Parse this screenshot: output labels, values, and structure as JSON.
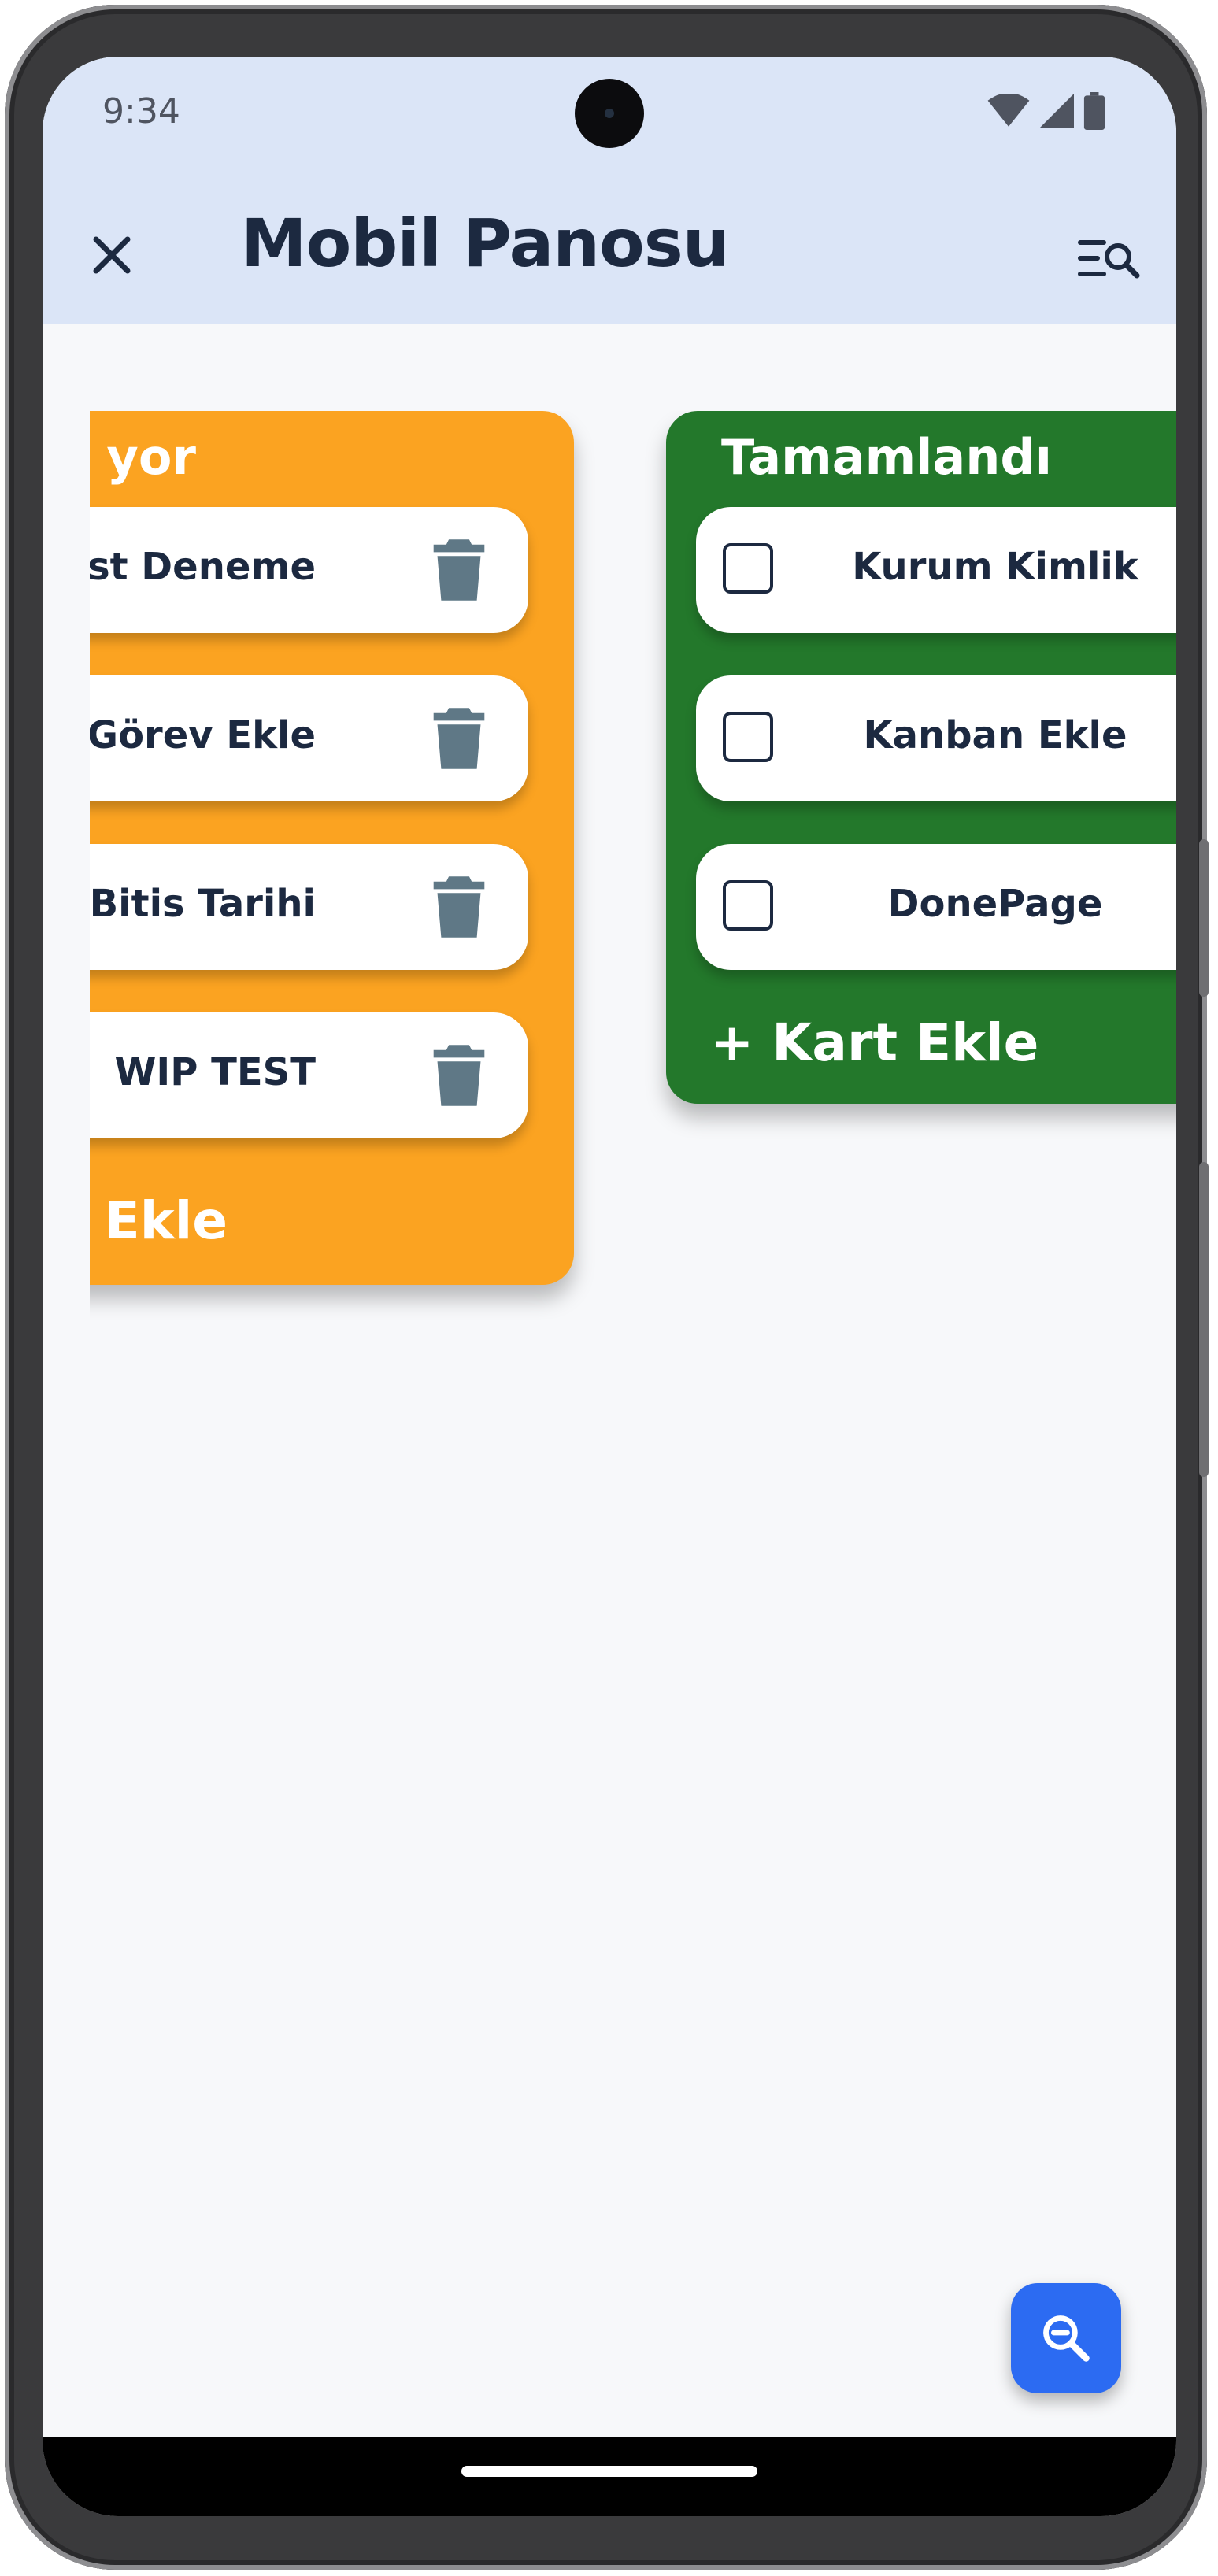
{
  "status_bar": {
    "time": "9:34"
  },
  "app_bar": {
    "title": "Mobil Panosu"
  },
  "columns": [
    {
      "title": "yor",
      "color": "#fba321",
      "cards": [
        {
          "text": "est Deneme"
        },
        {
          "text": "Görev Ekle"
        },
        {
          "text": "Bitis Tarihi"
        },
        {
          "text": "WIP TEST"
        }
      ],
      "add_label": "Ekle"
    },
    {
      "title": "Tamamlandı",
      "color": "#23782b",
      "cards": [
        {
          "text": "Kurum Kimlik"
        },
        {
          "text": "Kanban Ekle"
        },
        {
          "text": "DonePage"
        }
      ],
      "add_label": "+ Kart Ekle"
    }
  ],
  "icons": {
    "close": "close-icon",
    "search_list": "search-list-icon",
    "trash": "trash-icon",
    "zoom_out": "zoom-out-icon"
  },
  "colors": {
    "app_bar_bg": "#dbe5f7",
    "title_text": "#1c2940",
    "fab": "#2c6bf2",
    "trash": "#5f7886"
  }
}
